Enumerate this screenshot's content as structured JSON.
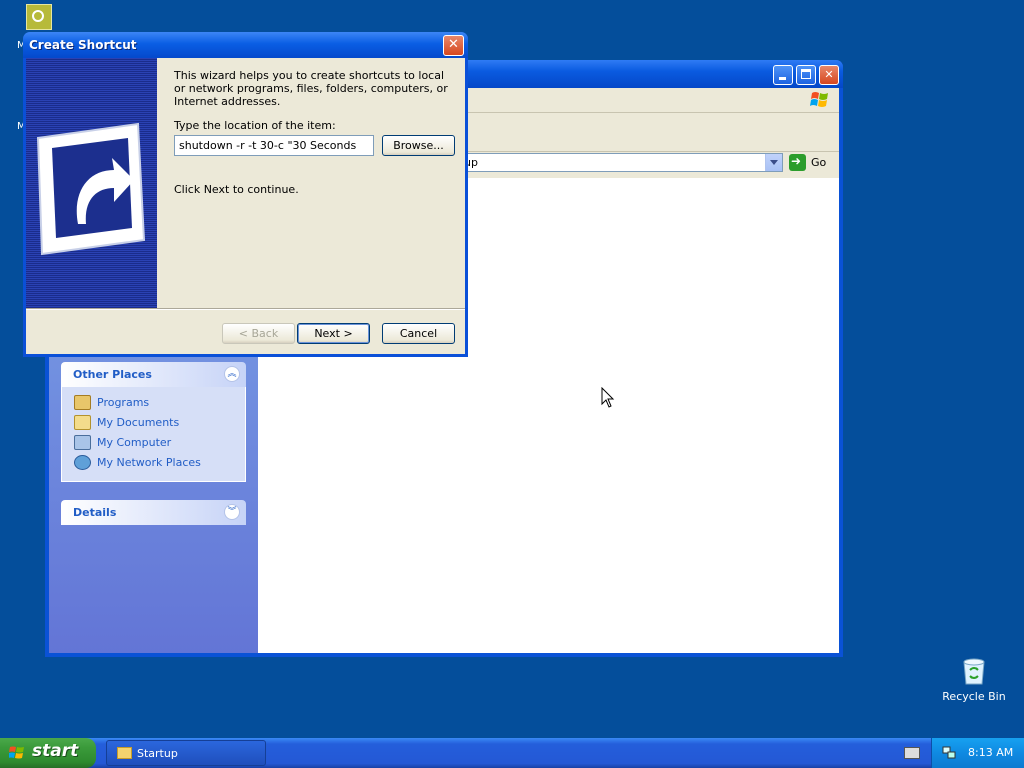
{
  "desktop": {
    "top_icon": "network-connection-icon",
    "fragment_1": "M",
    "fragment_2": "M",
    "recycle_bin_label": "Recycle Bin"
  },
  "explorer": {
    "address_value": "up",
    "go_label": "Go",
    "panels": [
      {
        "title": "Other Places",
        "items": [
          {
            "label": "Programs",
            "icon": "folder-programs-icon"
          },
          {
            "label": "My Documents",
            "icon": "my-documents-icon"
          },
          {
            "label": "My Computer",
            "icon": "my-computer-icon"
          },
          {
            "label": "My Network Places",
            "icon": "network-places-icon"
          }
        ]
      },
      {
        "title": "Details",
        "items": []
      }
    ]
  },
  "dialog": {
    "title": "Create Shortcut",
    "intro": "This wizard helps you to create shortcuts to local or network programs, files, folders, computers, or Internet addresses.",
    "location_label": "Type the location of the item:",
    "location_value": "shutdown -r -t 30-c \"30 Seconds",
    "browse_label": "Browse...",
    "continue_text": "Click Next to continue.",
    "back_label": "< Back",
    "next_label": "Next >",
    "cancel_label": "Cancel"
  },
  "taskbar": {
    "start_label": "start",
    "tasks": [
      {
        "label": "Startup"
      }
    ],
    "clock": "8:13 AM"
  },
  "colors": {
    "desktop": "#044e9b",
    "title_blue": "#0a5ee4",
    "start_green": "#3b9b3b",
    "taskpane_link": "#215dc6"
  }
}
